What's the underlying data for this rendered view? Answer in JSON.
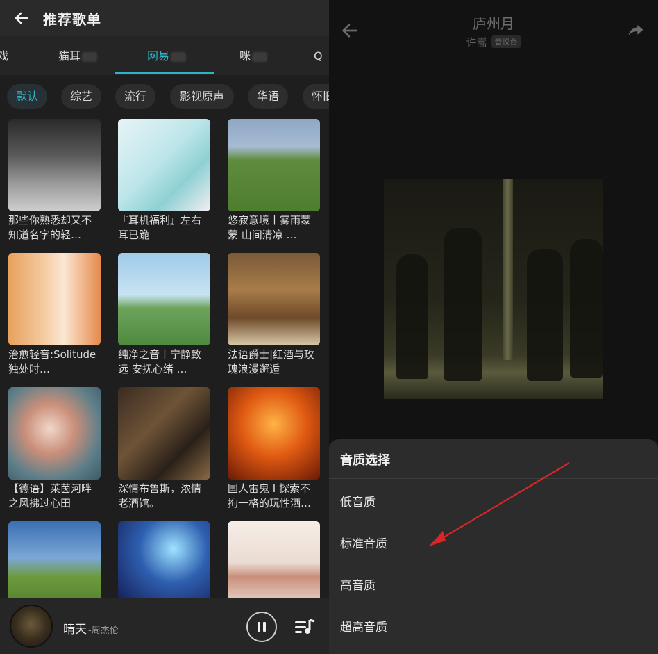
{
  "left": {
    "header": {
      "title": "推荐歌单"
    },
    "tabs": [
      {
        "label": "戏"
      },
      {
        "label": "猫耳"
      },
      {
        "label": "网易",
        "active": true
      },
      {
        "label": "咪"
      },
      {
        "label": "Q"
      }
    ],
    "chips": [
      {
        "label": "默认",
        "active": true
      },
      {
        "label": "综艺"
      },
      {
        "label": "流行"
      },
      {
        "label": "影视原声"
      },
      {
        "label": "华语"
      },
      {
        "label": "怀旧"
      }
    ],
    "playlists": [
      {
        "title": "那些你熟悉却又不知道名字的轻…"
      },
      {
        "title": "『耳机福利』左右耳已跪"
      },
      {
        "title": "悠寂意境丨雾雨蒙蒙 山间清凉 …"
      },
      {
        "title": "治愈轻音:Solitude独处时…"
      },
      {
        "title": "纯净之音丨宁静致远 安抚心绪 …"
      },
      {
        "title": "法语爵士|红酒与玫瑰浪漫邂逅"
      },
      {
        "title": "【德语】莱茵河畔之风拂过心田"
      },
      {
        "title": "深情布鲁斯，浓情老酒馆。"
      },
      {
        "title": "国人雷鬼 I 探索不拘一格的玩性洒…"
      },
      {
        "title": ""
      },
      {
        "title": ""
      },
      {
        "title": ""
      }
    ],
    "player": {
      "song": "晴天",
      "artist": "-周杰伦"
    }
  },
  "right": {
    "song_title": "庐州月",
    "artist": "许嵩",
    "badge": "音悦台",
    "sheet": {
      "title": "音质选择",
      "options": [
        "低音质",
        "标准音质",
        "高音质",
        "超高音质"
      ]
    }
  },
  "colors": {
    "accent": "#2fb3c7",
    "arrow": "#d62828"
  },
  "icons": {
    "back": "arrow-left-icon",
    "share": "share-icon",
    "pause": "pause-icon",
    "playlist": "playlist-icon"
  }
}
